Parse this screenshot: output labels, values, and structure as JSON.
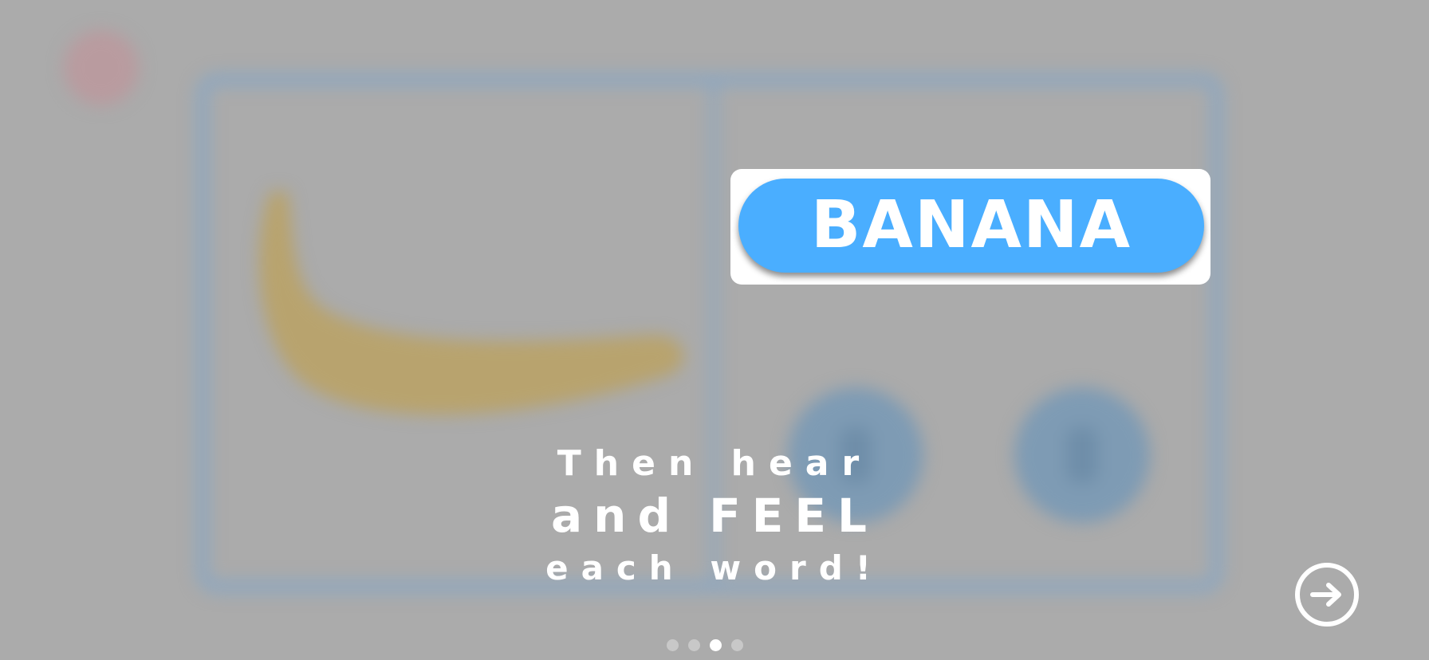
{
  "word_card": {
    "word": "BANANA"
  },
  "caption": {
    "line1": "Then hear",
    "line2": "and FEEL",
    "line3": "each word!"
  },
  "pagination": {
    "total_pages": 4,
    "current_page": 3
  },
  "icons": {
    "next": "arrow-right-circle-icon",
    "close": "close-icon",
    "speaker": "speaker-icon"
  },
  "colors": {
    "overlay_gray": "#ababab",
    "word_pill_blue": "#4aaeff",
    "card_frame_blue": "#8ea7bf",
    "close_red": "#b99b9f",
    "text_white": "#ffffff"
  }
}
